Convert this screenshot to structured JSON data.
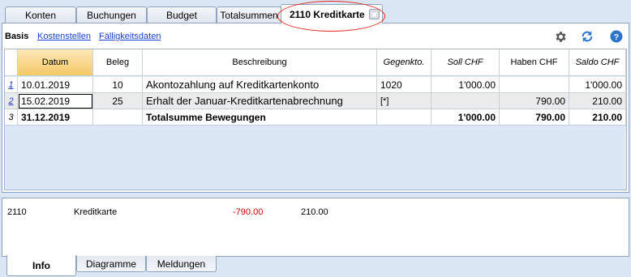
{
  "tabs": {
    "konten": "Konten",
    "buchungen": "Buchungen",
    "budget": "Budget",
    "totalsummen": "Totalsummen",
    "kreditkarte": "2110 Kreditkarte"
  },
  "views": {
    "basis": "Basis",
    "kostenstellen": "Kostenstellen",
    "faelligkeitsdaten": "Fälligkeitsdaten"
  },
  "toolbar": {
    "settings_icon": "gear-icon",
    "refresh_icon": "refresh-icon",
    "help_icon": "help-icon",
    "accent": "#1a3fc9"
  },
  "table": {
    "headers": {
      "datum": "Datum",
      "beleg": "Beleg",
      "beschreibung": "Beschreibung",
      "gegenkonto": "Gegenkto.",
      "soll": "Soll CHF",
      "haben": "Haben CHF",
      "saldo": "Saldo CHF"
    },
    "rows": [
      {
        "num": "1",
        "datum": "10.01.2019",
        "beleg": "10",
        "beschreibung": "Akontozahlung auf Kreditkartenkonto",
        "gegenkonto": "1020",
        "soll": "1'000.00",
        "haben": "",
        "saldo": "1'000.00"
      },
      {
        "num": "2",
        "datum": "15.02.2019",
        "beleg": "25",
        "beschreibung": "Erhalt der Januar-Kreditkartenabrechnung",
        "gegenkonto": "[*]",
        "soll": "",
        "haben": "790.00",
        "saldo": "210.00"
      },
      {
        "num": "3",
        "datum": "31.12.2019",
        "beleg": "",
        "beschreibung": "Totalsumme Bewegungen",
        "gegenkonto": "",
        "soll": "1'000.00",
        "haben": "790.00",
        "saldo": "210.00"
      }
    ]
  },
  "info": {
    "account": "2110",
    "description": "Kreditkarte",
    "amount_negative": "-790.00",
    "amount": "210.00",
    "negative_color": "#d00000"
  },
  "bottom_tabs": {
    "info": "Info",
    "diagramme": "Diagramme",
    "meldungen": "Meldungen"
  }
}
